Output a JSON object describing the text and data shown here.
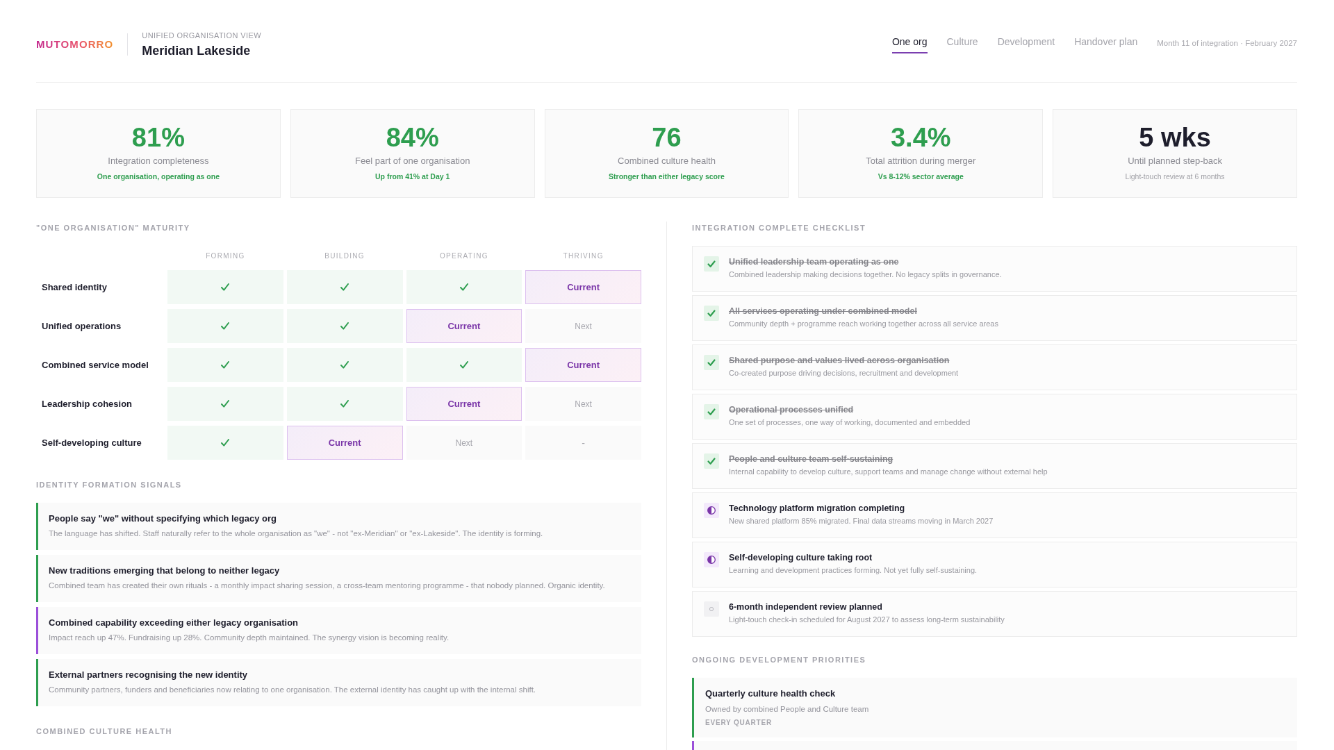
{
  "header": {
    "brand": "MUTOMORRO",
    "view_label": "UNIFIED ORGANISATION VIEW",
    "org_name": "Meridian Lakeside",
    "tabs": [
      {
        "label": "One org",
        "selected": true
      },
      {
        "label": "Culture",
        "selected": false
      },
      {
        "label": "Development",
        "selected": false
      },
      {
        "label": "Handover plan",
        "selected": false
      }
    ],
    "period": "Month 11 of integration · February 2027"
  },
  "kpis": [
    {
      "value": "81%",
      "label": "Integration completeness",
      "note": "One organisation, operating as one",
      "positive": true
    },
    {
      "value": "84%",
      "label": "Feel part of one organisation",
      "note": "Up from 41% at Day 1",
      "positive": true
    },
    {
      "value": "76",
      "label": "Combined culture health",
      "note": "Stronger than either legacy score",
      "positive": true
    },
    {
      "value": "3.4%",
      "label": "Total attrition during merger",
      "note": "Vs 8-12% sector average",
      "positive": true
    },
    {
      "value": "5 wks",
      "label": "Until planned step-back",
      "note": "Light-touch review at 6 months",
      "positive": false
    }
  ],
  "maturity": {
    "title": "\"ONE ORGANISATION\" MATURITY",
    "columns": [
      "FORMING",
      "BUILDING",
      "OPERATING",
      "THRIVING"
    ],
    "rows": [
      {
        "label": "Shared identity",
        "cells": [
          {
            "kind": "done"
          },
          {
            "kind": "done"
          },
          {
            "kind": "done"
          },
          {
            "kind": "current",
            "label": "Current"
          }
        ]
      },
      {
        "label": "Unified operations",
        "cells": [
          {
            "kind": "done"
          },
          {
            "kind": "done"
          },
          {
            "kind": "current",
            "label": "Current"
          },
          {
            "kind": "next",
            "label": "Next"
          }
        ]
      },
      {
        "label": "Combined service model",
        "cells": [
          {
            "kind": "done"
          },
          {
            "kind": "done"
          },
          {
            "kind": "done"
          },
          {
            "kind": "current",
            "label": "Current"
          }
        ]
      },
      {
        "label": "Leadership cohesion",
        "cells": [
          {
            "kind": "done"
          },
          {
            "kind": "done"
          },
          {
            "kind": "current",
            "label": "Current"
          },
          {
            "kind": "next",
            "label": "Next"
          }
        ]
      },
      {
        "label": "Self-developing culture",
        "cells": [
          {
            "kind": "done"
          },
          {
            "kind": "current",
            "label": "Current"
          },
          {
            "kind": "next",
            "label": "Next"
          },
          {
            "kind": "empty",
            "label": "-"
          }
        ]
      }
    ]
  },
  "signals": {
    "title": "IDENTITY FORMATION SIGNALS",
    "items": [
      {
        "title": "People say \"we\" without specifying which legacy org",
        "description": "The language has shifted. Staff naturally refer to the whole organisation as \"we\" - not \"ex-Meridian\" or \"ex-Lakeside\". The identity is forming.",
        "color": "#2e9e4f"
      },
      {
        "title": "New traditions emerging that belong to neither legacy",
        "description": "Combined team has created their own rituals - a monthly impact sharing session, a cross-team mentoring programme - that nobody planned. Organic identity.",
        "color": "#2e9e4f"
      },
      {
        "title": "Combined capability exceeding either legacy organisation",
        "description": "Impact reach up 47%. Fundraising up 28%. Community depth maintained. The synergy vision is becoming reality.",
        "color": "#9b4fd9"
      },
      {
        "title": "External partners recognising the new identity",
        "description": "Community partners, funders and beneficiaries now relating to one organisation. The external identity has caught up with the internal shift.",
        "color": "#2e9e4f"
      }
    ]
  },
  "culture_health": {
    "title": "COMBINED CULTURE HEALTH"
  },
  "checklist": {
    "title": "INTEGRATION COMPLETE CHECKLIST",
    "items": [
      {
        "title": "Unified leadership team operating as one",
        "description": "Combined leadership making decisions together. No legacy splits in governance.",
        "kind": "done"
      },
      {
        "title": "All services operating under combined model",
        "description": "Community depth + programme reach working together across all service areas",
        "kind": "done"
      },
      {
        "title": "Shared purpose and values lived across organisation",
        "description": "Co-created purpose driving decisions, recruitment and development",
        "kind": "done"
      },
      {
        "title": "Operational processes unified",
        "description": "One set of processes, one way of working, documented and embedded",
        "kind": "done"
      },
      {
        "title": "People and culture team self-sustaining",
        "description": "Internal capability to develop culture, support teams and manage change without external help",
        "kind": "done"
      },
      {
        "title": "Technology platform migration completing",
        "description": "New shared platform 85% migrated. Final data streams moving in March 2027",
        "kind": "partial"
      },
      {
        "title": "Self-developing culture taking root",
        "description": "Learning and development practices forming. Not yet fully self-sustaining.",
        "kind": "partial"
      },
      {
        "title": "6-month independent review planned",
        "description": "Light-touch check-in scheduled for August 2027 to assess long-term sustainability",
        "kind": "pending"
      }
    ]
  },
  "priorities": {
    "title": "ONGOING DEVELOPMENT PRIORITIES",
    "items": [
      {
        "title": "Quarterly culture health check",
        "owner": "Owned by combined People and Culture team",
        "frequency": "EVERY QUARTER",
        "color": "#2e9e4f"
      },
      {
        "color": "#9b4fd9"
      }
    ]
  }
}
